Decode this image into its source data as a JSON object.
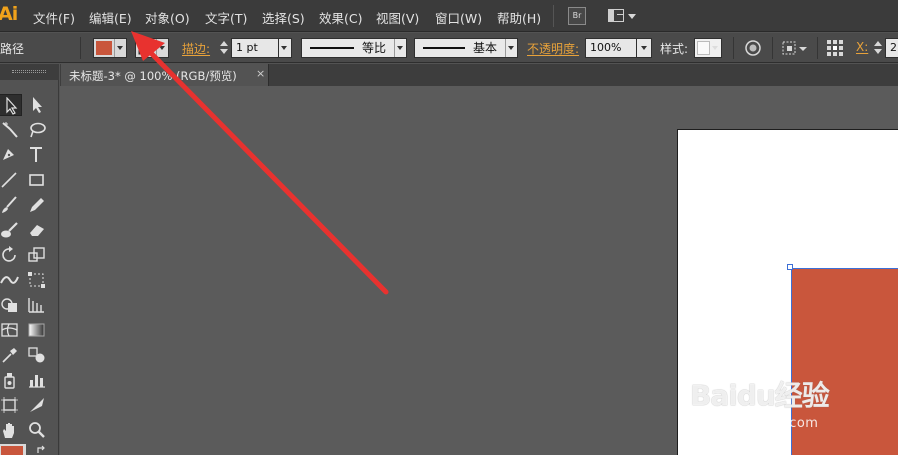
{
  "app": {
    "logo": "Ai"
  },
  "menu": {
    "items": [
      "文件(F)",
      "编辑(E)",
      "对象(O)",
      "文字(T)",
      "选择(S)",
      "效果(C)",
      "视图(V)",
      "窗口(W)",
      "帮助(H)"
    ],
    "bridge_label": "Br"
  },
  "control_bar": {
    "selection_type": "路径",
    "fill_color": "#c9563c",
    "stroke_label": "描边:",
    "stroke_weight": "1 pt",
    "variable_width": "等比",
    "brush": "基本",
    "opacity_label": "不透明度:",
    "opacity_value": "100%",
    "style_label": "样式:",
    "x_label": "X:",
    "x_value": "2"
  },
  "document": {
    "tab_title": "未标题-3* @ 100% (RGB/预览)",
    "close_glyph": "×"
  },
  "canvas": {
    "rect_color": "#c9563c",
    "selection_color": "#3d6fd6"
  },
  "annotation": {
    "arrow_color": "#e8322f"
  },
  "watermark": {
    "main": "Baidu经验",
    "sub": "jingyan.baidu.com"
  }
}
